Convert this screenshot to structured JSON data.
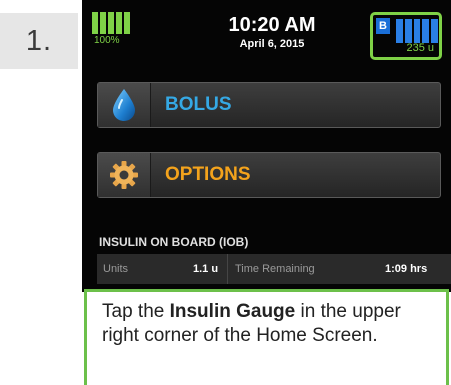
{
  "step": {
    "number": "1."
  },
  "status_bar": {
    "battery_percent": "100%",
    "time": "10:20 AM",
    "date": "April 6, 2015",
    "insulin_gauge": {
      "badge": "B",
      "units": "235 u"
    }
  },
  "menu": {
    "bolus_label": "BOLUS",
    "options_label": "OPTIONS"
  },
  "iob": {
    "title": "INSULIN ON BOARD (IOB)",
    "units_label": "Units",
    "units_value": "1.1 u",
    "time_label": "Time Remaining",
    "time_value": "1:09 hrs"
  },
  "instruction": {
    "prefix": "Tap the ",
    "emphasis": "Insulin Gauge",
    "suffix": " in the upper right corner of the Home Screen."
  },
  "colors": {
    "battery_green": "#7fd247",
    "gauge_border_green": "#7fd247",
    "gauge_blue": "#2a7fe6",
    "bolus_blue": "#35a9e5",
    "options_orange": "#f4a31c",
    "callout_border": "#6cc04a",
    "device_background": "#050505"
  },
  "icons": {
    "bolus": "droplet-icon",
    "options": "gear-icon",
    "battery": "battery-icon",
    "insulin_gauge": "insulin-gauge-icon"
  }
}
